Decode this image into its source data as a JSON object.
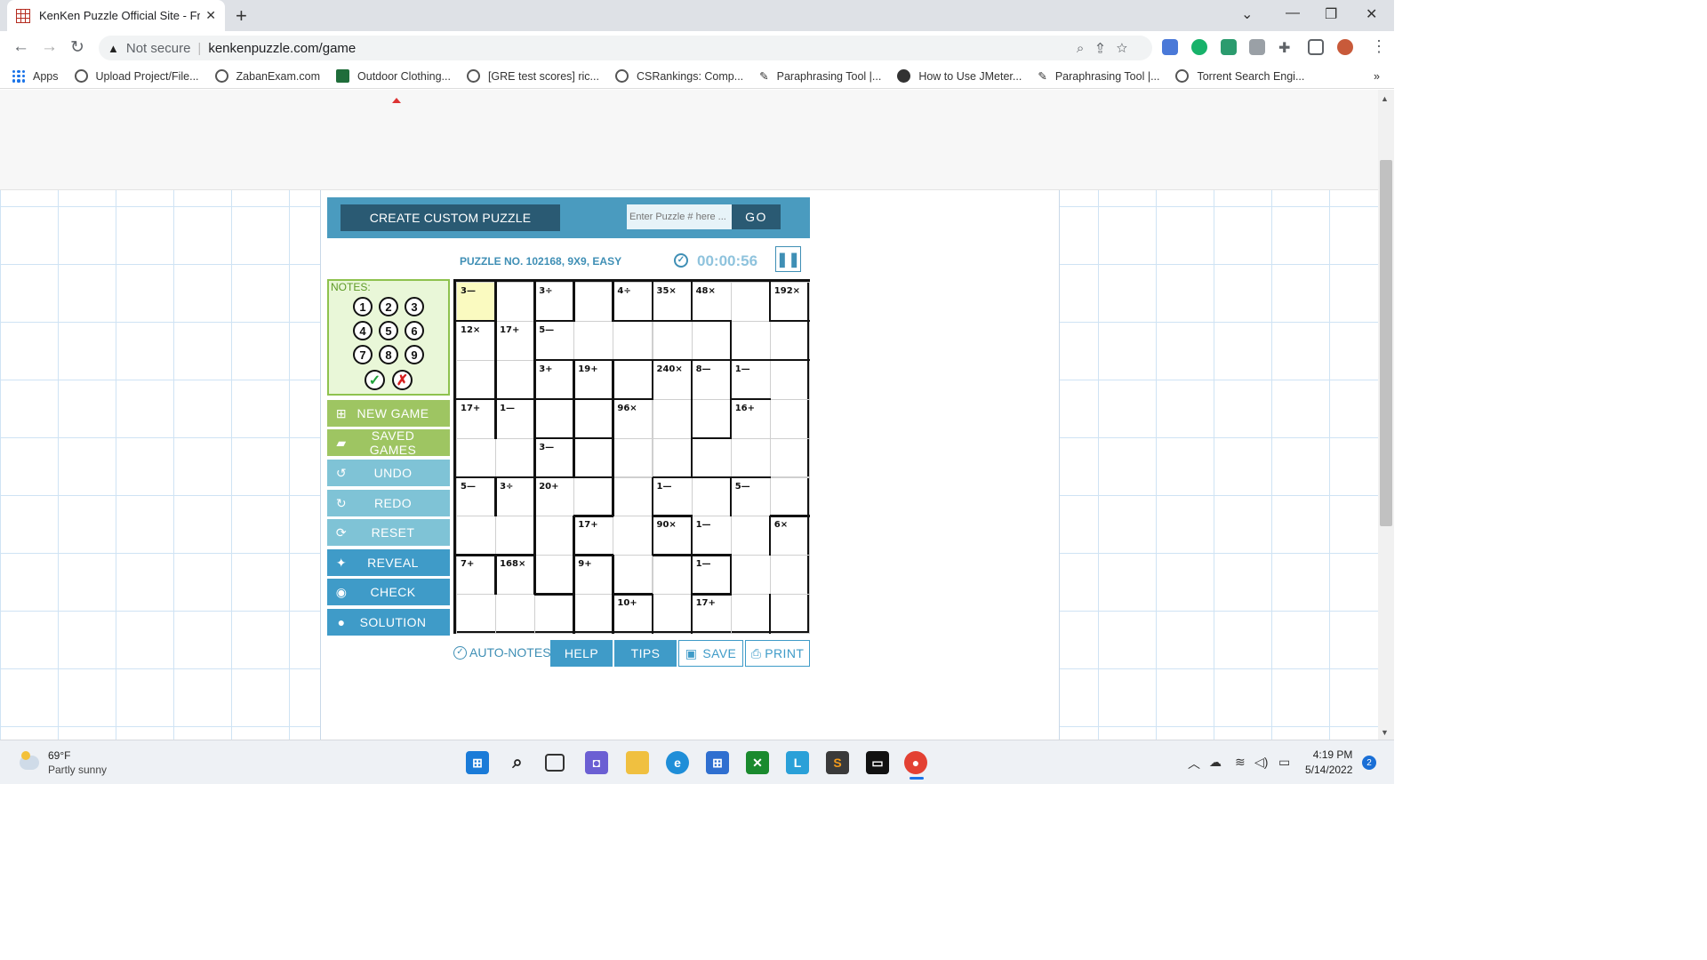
{
  "browser": {
    "tab_title": "KenKen Puzzle Official Site - Free",
    "security": "Not secure",
    "url": "kenkenpuzzle.com/game",
    "bookmarks": [
      "Apps",
      "Upload Project/File...",
      "ZabanExam.com",
      "Outdoor Clothing...",
      "[GRE test scores] ric...",
      "CSRankings: Comp...",
      "Paraphrasing Tool |...",
      "How to Use JMeter...",
      "Paraphrasing Tool |...",
      "Torrent Search Engi..."
    ]
  },
  "toolbar": {
    "create_label": "CREATE CUSTOM PUZZLE",
    "puzzle_placeholder": "Enter Puzzle # here ...",
    "go_label": "GO"
  },
  "puzzle": {
    "info": "PUZZLE NO. 102168, 9X9, EASY",
    "timer": "00:00:56",
    "selected_cell": [
      0,
      0
    ],
    "cages": [
      {
        "r": 0,
        "c": 0,
        "label": "3—"
      },
      {
        "r": 0,
        "c": 2,
        "label": "3÷"
      },
      {
        "r": 0,
        "c": 4,
        "label": "4÷"
      },
      {
        "r": 0,
        "c": 5,
        "label": "35×"
      },
      {
        "r": 0,
        "c": 6,
        "label": "48×"
      },
      {
        "r": 0,
        "c": 8,
        "label": "192×"
      },
      {
        "r": 1,
        "c": 0,
        "label": "12×"
      },
      {
        "r": 1,
        "c": 1,
        "label": "17+"
      },
      {
        "r": 1,
        "c": 2,
        "label": "5—"
      },
      {
        "r": 2,
        "c": 2,
        "label": "3+"
      },
      {
        "r": 2,
        "c": 3,
        "label": "19+"
      },
      {
        "r": 2,
        "c": 5,
        "label": "240×"
      },
      {
        "r": 2,
        "c": 6,
        "label": "8—"
      },
      {
        "r": 2,
        "c": 7,
        "label": "1—"
      },
      {
        "r": 3,
        "c": 0,
        "label": "17+"
      },
      {
        "r": 3,
        "c": 1,
        "label": "1—"
      },
      {
        "r": 3,
        "c": 4,
        "label": "96×"
      },
      {
        "r": 3,
        "c": 7,
        "label": "16+"
      },
      {
        "r": 4,
        "c": 2,
        "label": "3—"
      },
      {
        "r": 5,
        "c": 0,
        "label": "5—"
      },
      {
        "r": 5,
        "c": 1,
        "label": "3÷"
      },
      {
        "r": 5,
        "c": 2,
        "label": "20+"
      },
      {
        "r": 5,
        "c": 5,
        "label": "1—"
      },
      {
        "r": 5,
        "c": 7,
        "label": "5—"
      },
      {
        "r": 6,
        "c": 3,
        "label": "17+"
      },
      {
        "r": 6,
        "c": 5,
        "label": "90×"
      },
      {
        "r": 6,
        "c": 6,
        "label": "1—"
      },
      {
        "r": 6,
        "c": 8,
        "label": "6×"
      },
      {
        "r": 7,
        "c": 0,
        "label": "7+"
      },
      {
        "r": 7,
        "c": 1,
        "label": "168×"
      },
      {
        "r": 7,
        "c": 3,
        "label": "9+"
      },
      {
        "r": 7,
        "c": 6,
        "label": "1—"
      },
      {
        "r": 8,
        "c": 4,
        "label": "10+"
      },
      {
        "r": 8,
        "c": 6,
        "label": "17+"
      }
    ]
  },
  "notes": {
    "label": "NOTES:",
    "numbers": [
      "1",
      "2",
      "3",
      "4",
      "5",
      "6",
      "7",
      "8",
      "9"
    ]
  },
  "side_buttons": [
    {
      "id": "new-game",
      "label": "NEW GAME",
      "icon": "plus-folder-icon",
      "color": "#9ec562"
    },
    {
      "id": "saved-games",
      "label": "SAVED GAMES",
      "icon": "folder-open-icon",
      "color": "#9ec562"
    },
    {
      "id": "undo",
      "label": "UNDO",
      "icon": "undo-icon",
      "color": "#7fc3d6"
    },
    {
      "id": "redo",
      "label": "REDO",
      "icon": "redo-icon",
      "color": "#7fc3d6"
    },
    {
      "id": "reset",
      "label": "RESET",
      "icon": "reset-icon",
      "color": "#7fc3d6"
    },
    {
      "id": "reveal",
      "label": "REVEAL",
      "icon": "wand-icon",
      "color": "#3f9bc8"
    },
    {
      "id": "check",
      "label": "CHECK",
      "icon": "eye-icon",
      "color": "#3f9bc8"
    },
    {
      "id": "solution",
      "label": "SOLUTION",
      "icon": "bulb-icon",
      "color": "#3f9bc8"
    }
  ],
  "bottom": {
    "autonotes": "AUTO-NOTES",
    "help": "HELP",
    "tips": "TIPS",
    "save": "SAVE",
    "print": "PRINT"
  },
  "taskbar": {
    "weather_temp": "69°F",
    "weather_desc": "Partly sunny",
    "time": "4:19 PM",
    "date": "5/14/2022",
    "notifications": "2"
  },
  "colors": {
    "accent": "#4a9bbf",
    "dark": "#2a5a73",
    "green": "#9ec562",
    "selected_cell": "#fafac0"
  }
}
